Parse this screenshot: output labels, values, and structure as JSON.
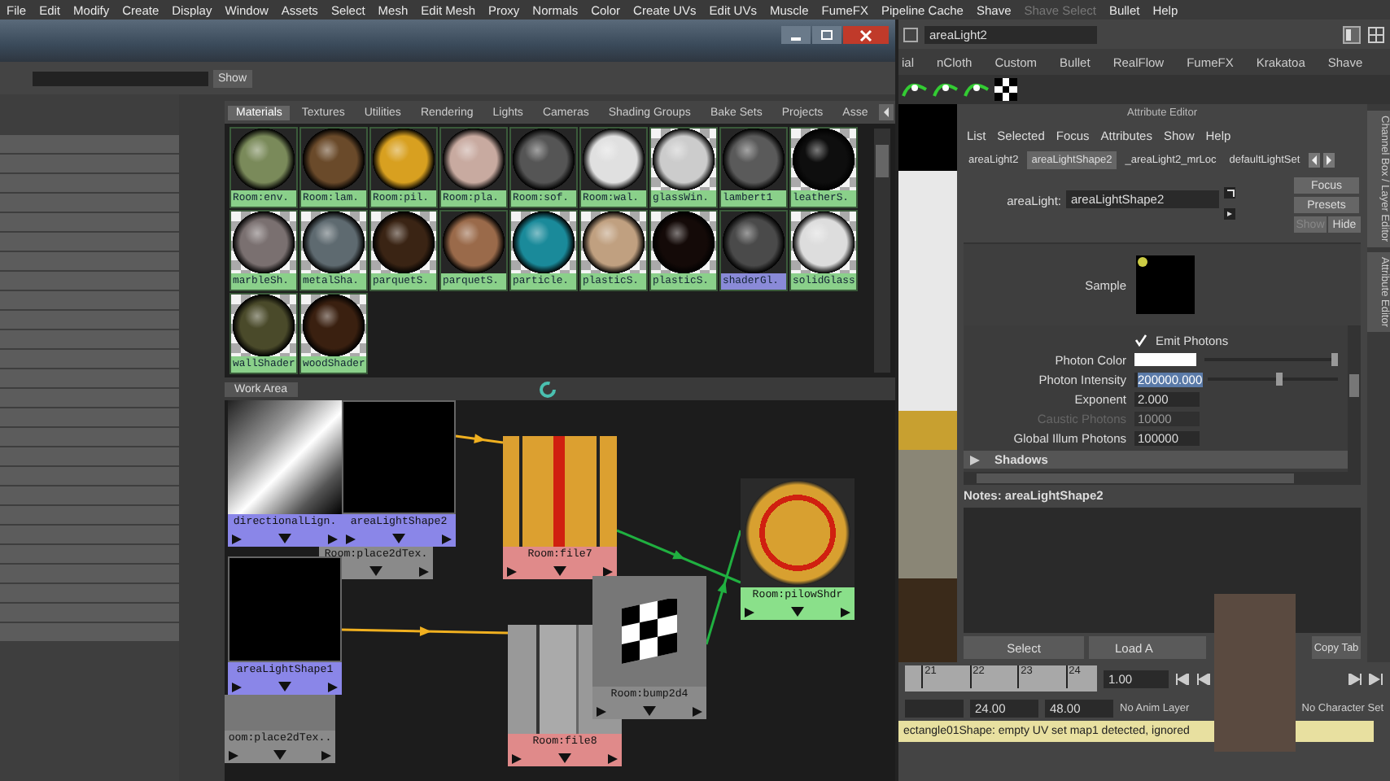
{
  "menu": [
    {
      "label": "File",
      "disabled": false
    },
    {
      "label": "Edit",
      "disabled": false
    },
    {
      "label": "Modify",
      "disabled": false
    },
    {
      "label": "Create",
      "disabled": false
    },
    {
      "label": "Display",
      "disabled": false
    },
    {
      "label": "Window",
      "disabled": false
    },
    {
      "label": "Assets",
      "disabled": false
    },
    {
      "label": "Select",
      "disabled": false
    },
    {
      "label": "Mesh",
      "disabled": false
    },
    {
      "label": "Edit Mesh",
      "disabled": false
    },
    {
      "label": "Proxy",
      "disabled": false
    },
    {
      "label": "Normals",
      "disabled": false
    },
    {
      "label": "Color",
      "disabled": false
    },
    {
      "label": "Create UVs",
      "disabled": false
    },
    {
      "label": "Edit UVs",
      "disabled": false
    },
    {
      "label": "Muscle",
      "disabled": false
    },
    {
      "label": "FumeFX",
      "disabled": false
    },
    {
      "label": "Pipeline Cache",
      "disabled": false
    },
    {
      "label": "Shave",
      "disabled": false
    },
    {
      "label": "Shave Select",
      "disabled": true
    },
    {
      "label": "Bullet",
      "disabled": false
    },
    {
      "label": "Help",
      "disabled": false
    }
  ],
  "hypershade": {
    "search_button": "Show",
    "tabs": [
      {
        "label": "Materials",
        "selected": true
      },
      {
        "label": "Textures",
        "selected": false
      },
      {
        "label": "Utilities",
        "selected": false
      },
      {
        "label": "Rendering",
        "selected": false
      },
      {
        "label": "Lights",
        "selected": false
      },
      {
        "label": "Cameras",
        "selected": false
      },
      {
        "label": "Shading Groups",
        "selected": false
      },
      {
        "label": "Bake Sets",
        "selected": false
      },
      {
        "label": "Projects",
        "selected": false
      },
      {
        "label": "Asse",
        "selected": false
      }
    ],
    "materials": [
      {
        "label": "Room:env.",
        "color": "#7a8a5a",
        "checker": false,
        "selected": false
      },
      {
        "label": "Room:lam.",
        "color": "#6a4a2a",
        "checker": false,
        "selected": false
      },
      {
        "label": "Room:pil.",
        "color": "#d8a020",
        "checker": false,
        "selected": false
      },
      {
        "label": "Room:pla.",
        "color": "#c8aaa0",
        "checker": false,
        "selected": false
      },
      {
        "label": "Room:sof.",
        "color": "#555555",
        "checker": false,
        "selected": false
      },
      {
        "label": "Room:wal.",
        "color": "#e0e0e0",
        "checker": false,
        "selected": false
      },
      {
        "label": "glassWin.",
        "color": "#cccccc",
        "checker": true,
        "selected": false
      },
      {
        "label": "lambert1",
        "color": "#5a5a5a",
        "checker": false,
        "selected": false
      },
      {
        "label": "leatherS.",
        "color": "#0e0e0e",
        "checker": true,
        "selected": false
      },
      {
        "label": "marbleSh.",
        "color": "#7a7070",
        "checker": true,
        "selected": false
      },
      {
        "label": "metalSha.",
        "color": "#5e6a70",
        "checker": true,
        "selected": false
      },
      {
        "label": "parquetS.",
        "color": "#3a2414",
        "checker": true,
        "selected": false
      },
      {
        "label": "parquetS.",
        "color": "#9a6a4a",
        "checker": false,
        "selected": false
      },
      {
        "label": "particle.",
        "color": "#1a8a9a",
        "checker": true,
        "selected": false
      },
      {
        "label": "plasticS.",
        "color": "#c0a080",
        "checker": true,
        "selected": false
      },
      {
        "label": "plasticS.",
        "color": "#140a08",
        "checker": true,
        "selected": false
      },
      {
        "label": "shaderGl.",
        "color": "#4a4a4a",
        "checker": false,
        "selected": true
      },
      {
        "label": "solidGlass",
        "color": "#dddddd",
        "checker": true,
        "selected": false
      },
      {
        "label": "wallShader",
        "color": "#4a4a2a",
        "checker": true,
        "selected": false
      },
      {
        "label": "woodShader",
        "color": "#3a2010",
        "checker": true,
        "selected": false
      }
    ],
    "work_area_tab": "Work Area",
    "nodes": [
      {
        "label": "directionalLign.",
        "kind": "light"
      },
      {
        "label": "areaLightShape2",
        "kind": "light"
      },
      {
        "label": "Room:place2dTex.",
        "kind": "utility"
      },
      {
        "label": "areaLightShape1",
        "kind": "light"
      },
      {
        "label": "oom:place2dTex..",
        "kind": "utility"
      },
      {
        "label": "Room:file7",
        "kind": "texture"
      },
      {
        "label": "Room:file8",
        "kind": "texture"
      },
      {
        "label": "Room:bump2d4",
        "kind": "utility"
      },
      {
        "label": "Room:pilowShdr",
        "kind": "shader"
      }
    ]
  },
  "main": {
    "object_field": "areaLight2",
    "shelf_tabs": [
      "ial",
      "nCloth",
      "Custom",
      "Bullet",
      "RealFlow",
      "FumeFX",
      "Krakatoa",
      "Shave"
    ],
    "attribute_editor": {
      "title": "Attribute Editor",
      "menu": [
        "List",
        "Selected",
        "Focus",
        "Attributes",
        "Show",
        "Help"
      ],
      "tabs": [
        {
          "label": "areaLight2",
          "selected": false
        },
        {
          "label": "areaLightShape2",
          "selected": true
        },
        {
          "label": "_areaLight2_mrLoc",
          "selected": false
        },
        {
          "label": "defaultLightSet",
          "selected": false
        }
      ],
      "node_label": "areaLight:",
      "node_value": "areaLightShape2",
      "buttons": [
        {
          "label": "Focus",
          "disabled": false
        },
        {
          "label": "Presets",
          "disabled": false
        },
        {
          "label": "Show",
          "disabled": true
        },
        {
          "label": "Hide",
          "disabled": false
        }
      ],
      "sample_label": "Sample",
      "attributes": [
        {
          "kind": "checkbox",
          "label": "Emit Photons",
          "checked": true
        },
        {
          "kind": "color",
          "label": "Photon Color",
          "color": "#ffffff",
          "level": 0.97
        },
        {
          "kind": "slider",
          "label": "Photon Intensity",
          "value": "200000.000",
          "text_selected": true,
          "level": 0.55
        },
        {
          "kind": "field",
          "label": "Exponent",
          "value": "2.000",
          "disabled": false
        },
        {
          "kind": "field",
          "label": "Caustic Photons",
          "value": "10000",
          "disabled": true
        },
        {
          "kind": "field",
          "label": "Global Illum Photons",
          "value": "100000",
          "disabled": false
        }
      ],
      "section": {
        "label": "Shadows",
        "expanded": false
      },
      "notes_label": "Notes: areaLightShape2",
      "actions": [
        "Select",
        "Load A",
        "Copy Tab"
      ]
    },
    "side_tabs": [
      "Channel Box / Layer Editor",
      "Attribute Editor"
    ],
    "timeline": {
      "ticks": [
        "21",
        "22",
        "23",
        "24"
      ],
      "current": "1.00",
      "range_start": "24.00",
      "range_end": "48.00",
      "anim_layer": "No Anim Layer",
      "character_set": "No Character Set"
    },
    "status": "ectangle01Shape: empty UV set map1 detected, ignored"
  }
}
